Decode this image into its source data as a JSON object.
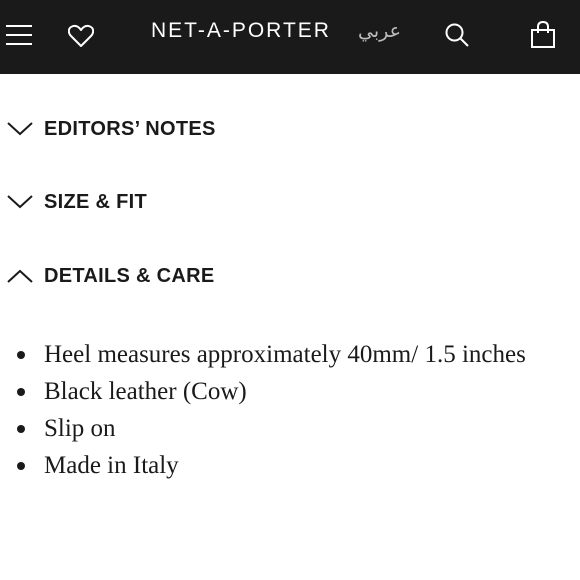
{
  "header": {
    "logo": "NET-A-PORTER",
    "language": "عربي",
    "icons": [
      "menu-icon",
      "heart-icon",
      "search-icon",
      "shopping-bag-icon"
    ]
  },
  "accordion": [
    {
      "label": "EDITORS’ NOTES",
      "state": "collapsed",
      "icon": "chevron-down-icon"
    },
    {
      "label": "SIZE & FIT",
      "state": "collapsed",
      "icon": "chevron-down-icon"
    },
    {
      "label": "DETAILS & CARE",
      "state": "expanded",
      "icon": "chevron-up-icon"
    }
  ],
  "details": {
    "items": [
      "Heel measures approximately 40mm/ 1.5 inches",
      "Black leather (Cow)",
      "Slip on",
      "Made in Italy"
    ]
  },
  "colors": {
    "header_bg": "#1a1a1a",
    "text": "#1a1a1a",
    "background": "#ffffff"
  }
}
